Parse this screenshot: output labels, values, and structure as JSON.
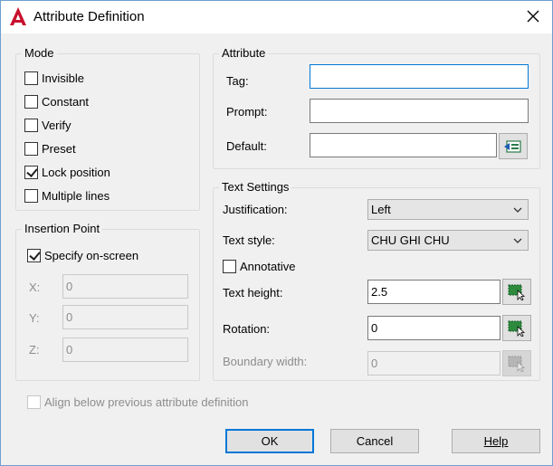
{
  "window": {
    "title": "Attribute Definition",
    "icon": "autocad-icon"
  },
  "mode": {
    "label": "Mode",
    "items": [
      {
        "label": "Invisible",
        "checked": false
      },
      {
        "label": "Constant",
        "checked": false
      },
      {
        "label": "Verify",
        "checked": false
      },
      {
        "label": "Preset",
        "checked": false
      },
      {
        "label": "Lock position",
        "checked": true
      },
      {
        "label": "Multiple lines",
        "checked": false
      }
    ]
  },
  "insertion": {
    "label": "Insertion Point",
    "specify_label": "Specify on-screen",
    "specify_checked": true,
    "x_label": "X:",
    "x_value": "0",
    "y_label": "Y:",
    "y_value": "0",
    "z_label": "Z:",
    "z_value": "0"
  },
  "attribute": {
    "label": "Attribute",
    "tag_label": "Tag:",
    "tag_value": "",
    "prompt_label": "Prompt:",
    "prompt_value": "",
    "default_label": "Default:",
    "default_value": ""
  },
  "text_settings": {
    "label": "Text Settings",
    "justification_label": "Justification:",
    "justification_value": "Left",
    "style_label": "Text style:",
    "style_value": "CHU GHI CHU",
    "annotative_label": "Annotative",
    "annotative_checked": false,
    "height_label": "Text height:",
    "height_value": "2.5",
    "rotation_label": "Rotation:",
    "rotation_value": "0",
    "boundary_label": "Boundary width:",
    "boundary_value": "0"
  },
  "align_label": "Align below previous attribute definition",
  "buttons": {
    "ok": "OK",
    "cancel": "Cancel",
    "help": "Help"
  },
  "colors": {
    "accent": "#0078d7",
    "app_red": "#c8102e"
  }
}
